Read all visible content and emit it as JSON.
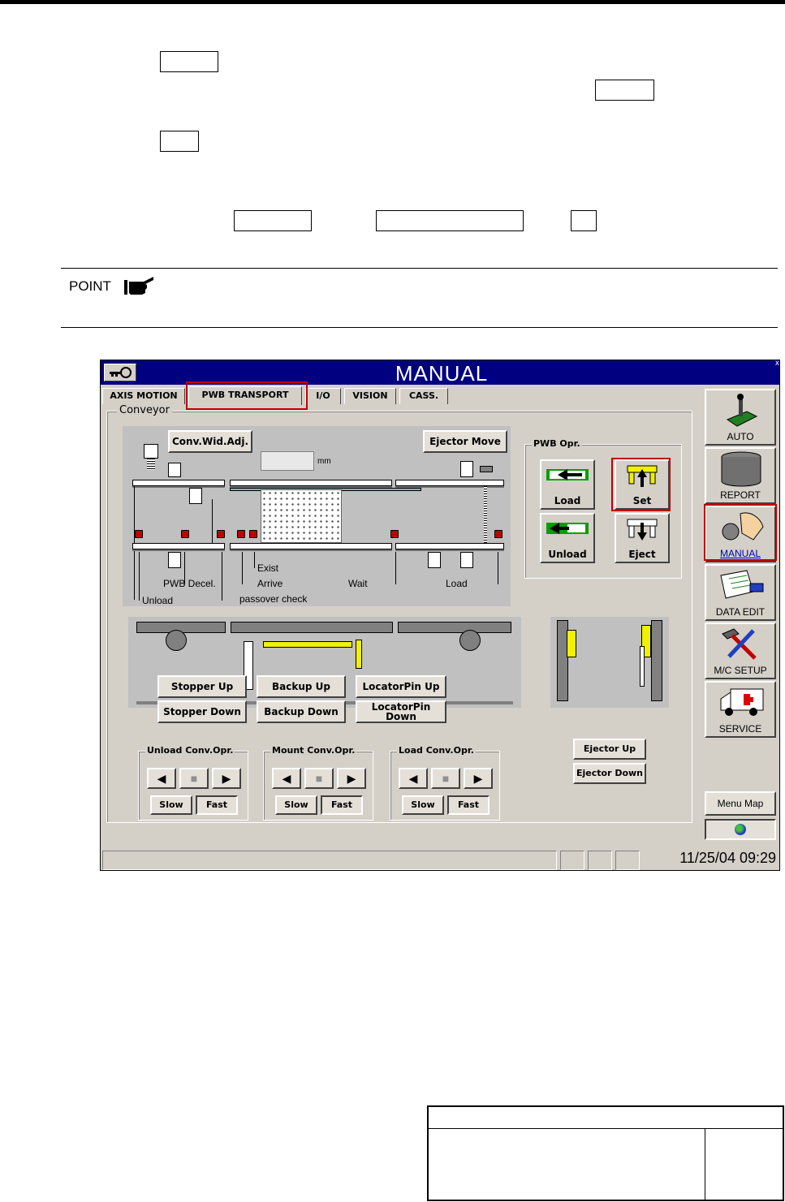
{
  "screen": {
    "title": "MANUAL",
    "tabs": [
      {
        "label": "AXIS MOTION"
      },
      {
        "label": "PWB TRANSPORT"
      },
      {
        "label": "I/O"
      },
      {
        "label": "VISION"
      },
      {
        "label": "CASS."
      }
    ],
    "active_tab": "PWB TRANSPORT",
    "conveyor": {
      "label": "Conveyor",
      "width_adjust_button": "Conv.Wid.Adj.",
      "width_unit": "mm",
      "ejector_move_button": "Ejector Move",
      "sensor_labels": {
        "exist": "Exist",
        "arrive": "Arrive",
        "wait": "Wait",
        "load": "Load",
        "pwb_decel": "PWB Decel.",
        "unload": "Unload",
        "passover_check": "passover check"
      },
      "stopper_up": "Stopper Up",
      "stopper_down": "Stopper Down",
      "backup_up": "Backup Up",
      "backup_down": "Backup Down",
      "locator_pin_up": "LocatorPin Up",
      "locator_pin_down": "LocatorPin Down",
      "ejector_up": "Ejector Up",
      "ejector_down": "Ejector Down"
    },
    "pwb_opr": {
      "label": "PWB Opr.",
      "load": "Load",
      "set": "Set",
      "unload": "Unload",
      "eject": "Eject"
    },
    "conv_groups": [
      {
        "label": "Unload Conv.Opr.",
        "slow": "Slow",
        "fast": "Fast"
      },
      {
        "label": "Mount Conv.Opr.",
        "slow": "Slow",
        "fast": "Fast"
      },
      {
        "label": "Load Conv.Opr.",
        "slow": "Slow",
        "fast": "Fast"
      }
    ],
    "sidebar": [
      {
        "label": "AUTO"
      },
      {
        "label": "REPORT"
      },
      {
        "label": "MANUAL"
      },
      {
        "label": "DATA EDIT"
      },
      {
        "label": "M/C SETUP"
      },
      {
        "label": "SERVICE"
      }
    ],
    "menu_map": "Menu Map",
    "status_time": "11/25/04 09:29"
  },
  "document": {
    "point_label": "POINT"
  }
}
